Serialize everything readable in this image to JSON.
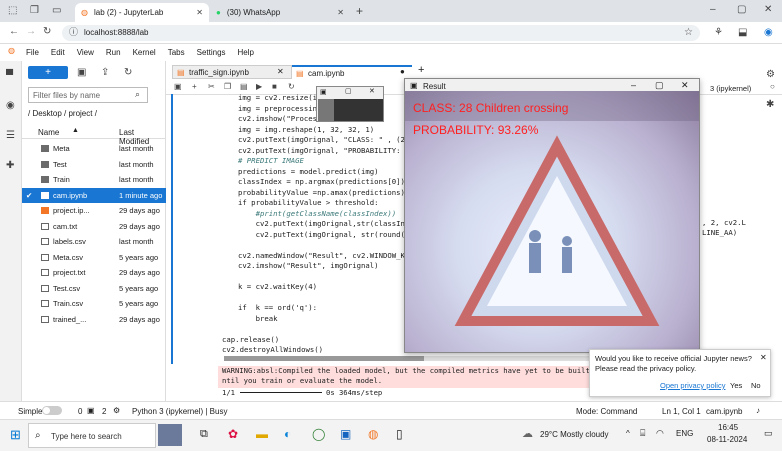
{
  "browser": {
    "tabs": [
      {
        "label": "lab (2) - JupyterLab"
      },
      {
        "label": "(30) WhatsApp"
      }
    ],
    "url": "localhost:8888/lab"
  },
  "menu": [
    "File",
    "Edit",
    "View",
    "Run",
    "Kernel",
    "Tabs",
    "Settings",
    "Help"
  ],
  "filebrowser": {
    "search_placeholder": "Filter files by name",
    "breadcrumb": "/ Desktop / project /",
    "col_name": "Name",
    "col_modified": "Last Modified",
    "files": [
      {
        "name": "Meta",
        "modified": "last month",
        "type": "folder"
      },
      {
        "name": "Test",
        "modified": "last month",
        "type": "folder"
      },
      {
        "name": "Train",
        "modified": "last month",
        "type": "folder"
      },
      {
        "name": "cam.ipynb",
        "modified": "1 minute ago",
        "type": "notebook",
        "selected": true
      },
      {
        "name": "project.ip...",
        "modified": "29 days ago",
        "type": "notebook"
      },
      {
        "name": "cam.txt",
        "modified": "29 days ago",
        "type": "file"
      },
      {
        "name": "labels.csv",
        "modified": "last month",
        "type": "file"
      },
      {
        "name": "Meta.csv",
        "modified": "5 years ago",
        "type": "file"
      },
      {
        "name": "project.txt",
        "modified": "29 days ago",
        "type": "file"
      },
      {
        "name": "Test.csv",
        "modified": "5 years ago",
        "type": "file"
      },
      {
        "name": "Train.csv",
        "modified": "5 years ago",
        "type": "file"
      },
      {
        "name": "trained_...",
        "modified": "29 days ago",
        "type": "file"
      }
    ]
  },
  "notebook": {
    "tabs": [
      "traffic_sign.ipynb",
      "cam.ipynb"
    ],
    "kernel": "3 (ipykernel)",
    "code": [
      "img = cv2.resize(im",
      "img = preprocessing",
      "cv2.imshow(\"Process",
      "img = img.reshape(1, 32, 32, 1)",
      "cv2.putText(imgOrignal, \"CLASS: \" , (20,",
      "cv2.putText(imgOrignal, \"PROBABILITY: \",",
      "# PREDICT IMAGE",
      "predictions = model.predict(img)",
      "classIndex = np.argmax(predictions[0])",
      "probabilityValue =np.amax(predictions)",
      "if probabilityValue > threshold:",
      "    #print(getClassName(classIndex))",
      "    cv2.putText(imgOrignal,str(classIndex",
      "    cv2.putText(imgOrignal, str(round(pre",
      "",
      "cv2.namedWindow(\"Result\", cv2.WINDOW_KEEP",
      "cv2.imshow(\"Result\", imgOrignal)",
      "",
      "k = cv2.waitKey(4)",
      "",
      "if  k == ord('q'):",
      "    break",
      "",
      "cap.release()",
      "cv2.destroyAllWindows()"
    ],
    "code_right_1": ", 2, cv2.L",
    "code_right_2": "LINE_AA)",
    "output_warning": "WARNING:absl:Compiled the loaded model, but the compiled metrics have yet to be built. `m",
    "output_warning2": "ntil you train or evaluate the model.",
    "output_progress": "1/1",
    "output_time": "0s 364ms/step"
  },
  "result_window": {
    "title": "Result",
    "class_text": "CLASS:  28 Children crossing",
    "prob_text": "PROBABILITY: 93.26%"
  },
  "popup": {
    "text1": "Would you like to receive official Jupyter news?",
    "text2": "Please read the privacy policy.",
    "link": "Open privacy policy",
    "yes": "Yes",
    "no": "No"
  },
  "status": {
    "mode": "Simple",
    "num1": "0",
    "num2": "2",
    "kernel": "Python 3 (ipykernel) | Busy",
    "cmdmode": "Mode: Command",
    "pos": "Ln 1, Col 1",
    "file": "cam.ipynb"
  },
  "taskbar": {
    "search": "Type here to search",
    "weather": "29°C  Mostly cloudy",
    "lang": "ENG",
    "time": "16:45",
    "date": "08-11-2024"
  }
}
